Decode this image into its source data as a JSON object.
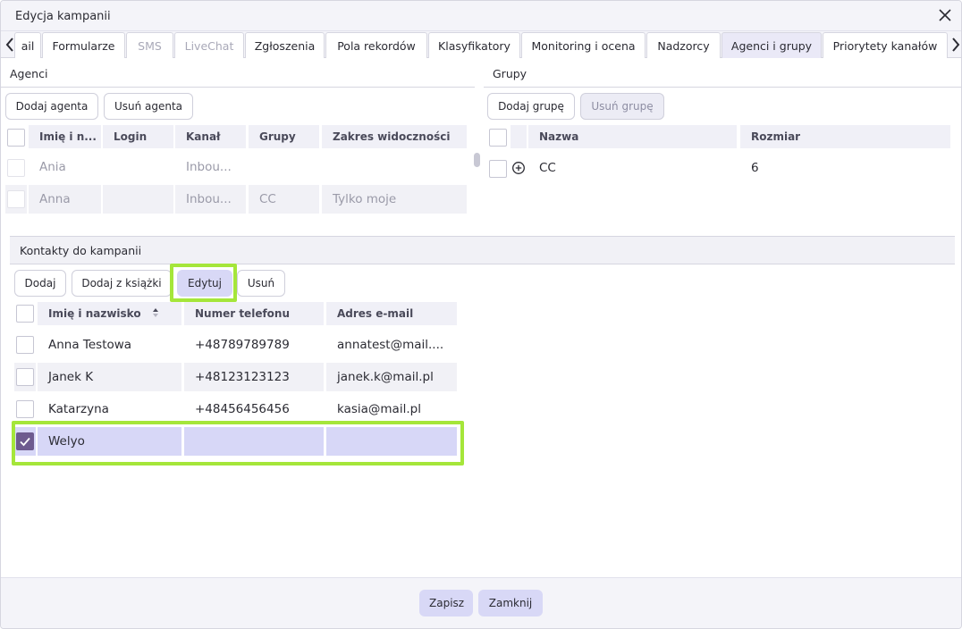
{
  "window": {
    "title": "Edycja kampanii"
  },
  "tabs": [
    {
      "label": "ail",
      "state": "normal"
    },
    {
      "label": "Formularze",
      "state": "normal"
    },
    {
      "label": "SMS",
      "state": "disabled"
    },
    {
      "label": "LiveChat",
      "state": "disabled"
    },
    {
      "label": "Zgłoszenia",
      "state": "normal"
    },
    {
      "label": "Pola rekordów",
      "state": "normal"
    },
    {
      "label": "Klasyfikatory",
      "state": "normal"
    },
    {
      "label": "Monitoring i ocena",
      "state": "normal"
    },
    {
      "label": "Nadzorcy",
      "state": "normal"
    },
    {
      "label": "Agenci i grupy",
      "state": "active"
    },
    {
      "label": "Priorytety kanałów",
      "state": "normal"
    }
  ],
  "agents": {
    "title": "Agenci",
    "add_button": "Dodaj agenta",
    "remove_button": "Usuń agenta",
    "columns": [
      "Imię i n...",
      "Login",
      "Kanał",
      "Grupy",
      "Zakres widoczności"
    ],
    "rows": [
      {
        "name": "Ania",
        "login": "",
        "channel": "Inbou...",
        "groups": "",
        "scope": ""
      },
      {
        "name": "Anna",
        "login": "",
        "channel": "Inbou...",
        "groups": "CC",
        "scope": "Tylko moje"
      }
    ]
  },
  "groups": {
    "title": "Grupy",
    "add_button": "Dodaj grupę",
    "remove_button": "Usuń grupę",
    "columns": [
      "Nazwa",
      "Rozmiar"
    ],
    "rows": [
      {
        "name": "CC",
        "size": "6"
      }
    ]
  },
  "contacts": {
    "title": "Kontakty do kampanii",
    "buttons": {
      "add": "Dodaj",
      "add_from_book": "Dodaj z książki",
      "edit": "Edytuj",
      "remove": "Usuń"
    },
    "columns": [
      "Imię i nazwisko",
      "Numer telefonu",
      "Adres e-mail"
    ],
    "rows": [
      {
        "name": "Anna Testowa",
        "phone": "+48789789789",
        "email": "annatest@mail...."
      },
      {
        "name": "Janek K",
        "phone": "+48123123123",
        "email": "janek.k@mail.pl"
      },
      {
        "name": "Katarzyna",
        "phone": "+48456456456",
        "email": "kasia@mail.pl"
      },
      {
        "name": "Welyo",
        "phone": "",
        "email": ""
      }
    ]
  },
  "footer": {
    "save": "Zapisz",
    "close": "Zamknij"
  },
  "colors": {
    "accent": "#d8d8f6",
    "highlight": "#a5e63a",
    "checkbox_checked": "#6e5b8f"
  },
  "icons": {
    "close": "close-icon",
    "tab_prev": "chevron-left-icon",
    "tab_next": "chevron-right-icon",
    "sort": "sort-icon",
    "expand": "plus-circle-icon",
    "check": "check-icon"
  }
}
